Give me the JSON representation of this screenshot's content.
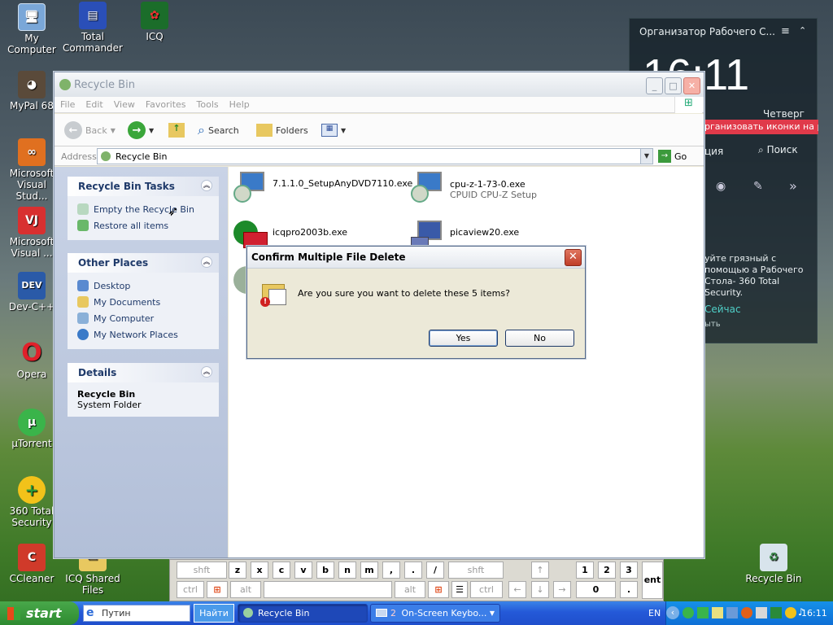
{
  "desktop_icons": [
    {
      "label": "My Computer"
    },
    {
      "label": "Total Commander"
    },
    {
      "label": "ICQ"
    },
    {
      "label": "MyPal 68"
    },
    {
      "label": "Microsoft Visual Stud..."
    },
    {
      "label": "Microsoft Visual ..."
    },
    {
      "label": "Dev-C++"
    },
    {
      "label": "Opera"
    },
    {
      "label": "µTorrent"
    },
    {
      "label": "360 Total Security"
    },
    {
      "label": "CCleaner"
    },
    {
      "label": "ICQ Shared Files"
    },
    {
      "label": "Recycle Bin"
    }
  ],
  "gadget": {
    "title": "Организатор Рабочего С...",
    "time": "16:11",
    "day": "Четверг",
    "banner": "рганизовать иконки на раб",
    "left_label": "ция",
    "search_label": "Поиск",
    "message": "уйте грязный с помощью а Рабочего Стола- 360 Total Security.",
    "link": "Сейчас",
    "hint": "ыть"
  },
  "window": {
    "title": "Recycle Bin",
    "menu": [
      "File",
      "Edit",
      "View",
      "Favorites",
      "Tools",
      "Help"
    ],
    "toolbar": {
      "back": "Back",
      "search": "Search",
      "folders": "Folders"
    },
    "address_label": "Address",
    "address_value": "Recycle Bin",
    "go_label": "Go",
    "tasks": {
      "title": "Recycle Bin Tasks",
      "items": [
        "Empty the Recycle Bin",
        "Restore all items"
      ]
    },
    "other_places": {
      "title": "Other Places",
      "items": [
        "Desktop",
        "My Documents",
        "My Computer",
        "My Network Places"
      ]
    },
    "details": {
      "title": "Details",
      "name": "Recycle Bin",
      "type": "System Folder"
    },
    "files": [
      {
        "name": "7.1.1.0_SetupAnyDVD7110.exe",
        "sub": ""
      },
      {
        "name": "cpu-z-1-73-0.exe",
        "sub": "CPUID CPU-Z Setup"
      },
      {
        "name": "icqpro2003b.exe",
        "sub": ""
      },
      {
        "name": "picaview20.exe",
        "sub": ""
      }
    ]
  },
  "dialog": {
    "title": "Confirm Multiple File Delete",
    "message": "Are you sure you want to delete these 5 items?",
    "yes": "Yes",
    "no": "No"
  },
  "keyboard": {
    "row1": [
      "shft",
      "z",
      "x",
      "c",
      "v",
      "b",
      "n",
      "m",
      ",",
      ".",
      "/",
      "shft",
      "↑",
      "1",
      "2",
      "3"
    ],
    "row2": [
      "ctrl",
      "alt",
      "alt",
      "ctrl",
      "←",
      "↓",
      "→",
      "0",
      "."
    ],
    "ent": "ent"
  },
  "taskbar": {
    "start": "start",
    "quick_search": "Путин",
    "find_button": "Найти",
    "items": [
      {
        "label": "Recycle Bin"
      },
      {
        "label": "On-Screen Keybo...",
        "count": "2"
      }
    ],
    "language": "EN",
    "clock": "16:11"
  }
}
